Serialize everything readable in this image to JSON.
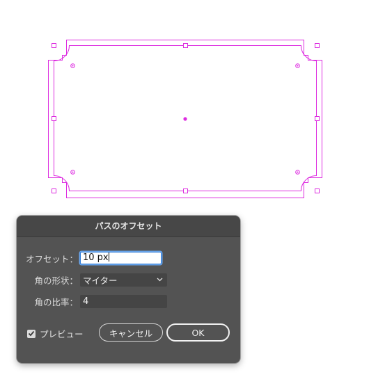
{
  "colors": {
    "selection_magenta": "#dd2ce0",
    "dialog_bg": "#535353",
    "focus_blue": "#2e7bd6"
  },
  "dialog": {
    "title": "パスのオフセット",
    "offset": {
      "label": "オフセット：",
      "value": "10 px"
    },
    "joins": {
      "label": "角の形状：",
      "value": "マイター",
      "icon": "chevron-down-icon"
    },
    "miter_limit": {
      "label": "角の比率：",
      "value": "4"
    },
    "preview": {
      "label": "プレビュー",
      "checked": true
    },
    "cancel_label": "キャンセル",
    "ok_label": "OK"
  }
}
